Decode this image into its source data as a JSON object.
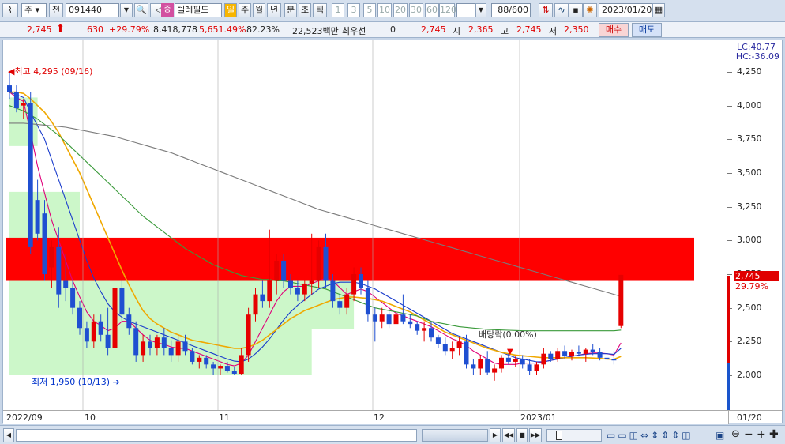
{
  "toolbar": {
    "market_type": "주",
    "prev_label": "전",
    "stock_code": "091440",
    "stock_name": "텔레필드",
    "stock_badge": "증",
    "periods": [
      "일",
      "주",
      "월",
      "년",
      "분",
      "초",
      "틱"
    ],
    "active_period": "일",
    "intervals": [
      "1",
      "3",
      "5",
      "10",
      "20",
      "30",
      "60",
      "120"
    ],
    "count_value": "88",
    "count_total": "/600",
    "date": "2023/01/20"
  },
  "quote": {
    "price": "2,745",
    "change": "630",
    "change_pct": "+29.79%",
    "volume": "8,418,778",
    "volume_ratio": "5,651.49%",
    "turnover": "82.23%",
    "amount": "22,523백만",
    "priority_label": "최우선",
    "priority_value": "0",
    "priority_price": "2,745",
    "open_label": "시",
    "open": "2,365",
    "high_label": "고",
    "high": "2,745",
    "low_label": "저",
    "low": "2,350",
    "buy_label": "매수",
    "sell_label": "매도"
  },
  "chart_labels": {
    "lc": "LC:40.77",
    "hc": "HC:-36.09",
    "high_marker": "최고 4,295 (09/16)",
    "low_marker": "최저 1,950 (10/13)",
    "dividend": "배당락(0.00%)",
    "price_tag": "2,745",
    "pct_tag": "29.79%",
    "x_labels": [
      "2022/09",
      "10",
      "11",
      "12",
      "2023/01"
    ],
    "axis_date": "01/20"
  },
  "chart_data": {
    "type": "candlestick",
    "y_ticks": [
      "4,250",
      "4,000",
      "3,750",
      "3,500",
      "3,250",
      "3,000",
      "2,750",
      "2,500",
      "2,250",
      "2,000"
    ],
    "ylim": [
      1900,
      4350
    ],
    "last_price": 2745,
    "last_change_pct": 29.79,
    "period_high": {
      "value": 4295,
      "date": "09/16"
    },
    "period_low": {
      "value": 1950,
      "date": "10/13"
    },
    "candles": [
      [
        4150,
        4250,
        4050,
        4100
      ],
      [
        4100,
        4150,
        3950,
        3980
      ],
      [
        4000,
        4050,
        3900,
        4020
      ],
      [
        4020,
        4100,
        2900,
        2950
      ],
      [
        3300,
        3450,
        3000,
        3050
      ],
      [
        3200,
        3300,
        2700,
        2750
      ],
      [
        2800,
        3000,
        2650,
        2950
      ],
      [
        2950,
        3100,
        2500,
        2600
      ],
      [
        2700,
        2900,
        2550,
        2650
      ],
      [
        2650,
        2700,
        2450,
        2500
      ],
      [
        2500,
        2550,
        2300,
        2350
      ],
      [
        2350,
        2400,
        2200,
        2250
      ],
      [
        2250,
        2450,
        2200,
        2400
      ],
      [
        2400,
        2450,
        2250,
        2300
      ],
      [
        2300,
        2500,
        2150,
        2200
      ],
      [
        2200,
        2700,
        2150,
        2650
      ],
      [
        2650,
        2700,
        2400,
        2450
      ],
      [
        2450,
        2500,
        2300,
        2350
      ],
      [
        2350,
        2400,
        2100,
        2150
      ],
      [
        2150,
        2300,
        2100,
        2250
      ],
      [
        2250,
        2300,
        2150,
        2200
      ],
      [
        2200,
        2300,
        2150,
        2280
      ],
      [
        2280,
        2350,
        2150,
        2200
      ],
      [
        2200,
        2260,
        2100,
        2150
      ],
      [
        2150,
        2300,
        2100,
        2250
      ],
      [
        2250,
        2300,
        2150,
        2180
      ],
      [
        2180,
        2200,
        2080,
        2100
      ],
      [
        2100,
        2150,
        2050,
        2130
      ],
      [
        2130,
        2150,
        2050,
        2080
      ],
      [
        2080,
        2100,
        2000,
        2050
      ],
      [
        2050,
        2080,
        2000,
        2070
      ],
      [
        2070,
        2100,
        2020,
        2030
      ],
      [
        2030,
        2060,
        2000,
        2010
      ],
      [
        2010,
        2200,
        2000,
        2150
      ],
      [
        2150,
        2500,
        2100,
        2450
      ],
      [
        2450,
        2650,
        2400,
        2600
      ],
      [
        2600,
        2700,
        2500,
        2550
      ],
      [
        2550,
        3080,
        2500,
        2700
      ],
      [
        2700,
        2900,
        2600,
        2850
      ],
      [
        2850,
        2900,
        2650,
        2700
      ],
      [
        2700,
        2750,
        2600,
        2650
      ],
      [
        2650,
        2700,
        2550,
        2600
      ],
      [
        2600,
        2700,
        2550,
        2680
      ],
      [
        2680,
        3050,
        2600,
        2700
      ],
      [
        2700,
        3000,
        2650,
        2950
      ],
      [
        2950,
        3050,
        2650,
        2700
      ],
      [
        2700,
        2750,
        2500,
        2550
      ],
      [
        2550,
        2600,
        2450,
        2500
      ],
      [
        2500,
        2650,
        2450,
        2600
      ],
      [
        2600,
        2800,
        2550,
        2750
      ],
      [
        2750,
        2800,
        2600,
        2650
      ],
      [
        2650,
        2700,
        2400,
        2450
      ],
      [
        2450,
        2500,
        2250,
        2400
      ],
      [
        2400,
        2500,
        2350,
        2450
      ],
      [
        2450,
        2500,
        2350,
        2380
      ],
      [
        2380,
        2500,
        2330,
        2450
      ],
      [
        2450,
        2600,
        2380,
        2400
      ],
      [
        2400,
        2450,
        2350,
        2380
      ],
      [
        2380,
        2400,
        2300,
        2330
      ],
      [
        2330,
        2400,
        2250,
        2350
      ],
      [
        2350,
        2400,
        2250,
        2280
      ],
      [
        2280,
        2300,
        2200,
        2230
      ],
      [
        2230,
        2280,
        2150,
        2180
      ],
      [
        2180,
        2250,
        2120,
        2200
      ],
      [
        2200,
        2280,
        2150,
        2250
      ],
      [
        2250,
        2300,
        2050,
        2080
      ],
      [
        2080,
        2120,
        2000,
        2050
      ],
      [
        2050,
        2150,
        2000,
        2120
      ],
      [
        2120,
        2180,
        2000,
        2020
      ],
      [
        2020,
        2080,
        1960,
        2050
      ],
      [
        2050,
        2150,
        2020,
        2130
      ],
      [
        2130,
        2160,
        2080,
        2100
      ],
      [
        2100,
        2140,
        2060,
        2120
      ],
      [
        2120,
        2150,
        2050,
        2080
      ],
      [
        2080,
        2120,
        2000,
        2030
      ],
      [
        2030,
        2100,
        2000,
        2080
      ],
      [
        2080,
        2200,
        2050,
        2160
      ],
      [
        2160,
        2180,
        2100,
        2120
      ],
      [
        2120,
        2200,
        2100,
        2180
      ],
      [
        2180,
        2220,
        2120,
        2140
      ],
      [
        2140,
        2190,
        2110,
        2170
      ],
      [
        2170,
        2220,
        2140,
        2160
      ],
      [
        2160,
        2200,
        2100,
        2190
      ],
      [
        2190,
        2230,
        2150,
        2170
      ],
      [
        2170,
        2200,
        2110,
        2130
      ],
      [
        2130,
        2180,
        2100,
        2120
      ],
      [
        2120,
        2180,
        2080,
        2110
      ],
      [
        2365,
        2745,
        2350,
        2745
      ]
    ],
    "series": [
      {
        "type": "ma",
        "color": "#e0007a",
        "values": [
          4100,
          4060,
          4030,
          3800,
          3550,
          3350,
          3150,
          3000,
          2850,
          2700,
          2580,
          2470,
          2400,
          2370,
          2330,
          2350,
          2400,
          2400,
          2350,
          2300,
          2260,
          2240,
          2230,
          2210,
          2200,
          2200,
          2180,
          2160,
          2140,
          2120,
          2100,
          2080,
          2070,
          2090,
          2150,
          2250,
          2350,
          2450,
          2550,
          2620,
          2660,
          2660,
          2660,
          2680,
          2700,
          2720,
          2700,
          2650,
          2600,
          2620,
          2640,
          2620,
          2580,
          2540,
          2500,
          2460,
          2440,
          2420,
          2400,
          2380,
          2360,
          2330,
          2300,
          2270,
          2250,
          2220,
          2180,
          2150,
          2120,
          2090,
          2080,
          2080,
          2080,
          2090,
          2090,
          2090,
          2100,
          2110,
          2120,
          2130,
          2140,
          2150,
          2160,
          2165,
          2165,
          2160,
          2150,
          2240
        ]
      },
      {
        "type": "ma",
        "color": "#1a3ccc",
        "values": [
          4100,
          4080,
          4060,
          3950,
          3850,
          3750,
          3600,
          3450,
          3300,
          3150,
          3000,
          2850,
          2720,
          2620,
          2530,
          2470,
          2430,
          2400,
          2380,
          2360,
          2340,
          2320,
          2300,
          2280,
          2260,
          2240,
          2220,
          2200,
          2180,
          2160,
          2140,
          2120,
          2105,
          2100,
          2120,
          2160,
          2210,
          2270,
          2340,
          2410,
          2470,
          2520,
          2560,
          2600,
          2640,
          2660,
          2680,
          2690,
          2690,
          2690,
          2680,
          2660,
          2640,
          2610,
          2580,
          2550,
          2520,
          2490,
          2460,
          2430,
          2400,
          2370,
          2340,
          2310,
          2290,
          2270,
          2250,
          2230,
          2210,
          2190,
          2170,
          2150,
          2130,
          2120,
          2110,
          2100,
          2100,
          2110,
          2120,
          2130,
          2140,
          2150,
          2155,
          2160,
          2160,
          2160,
          2155,
          2200
        ]
      },
      {
        "type": "ma",
        "color": "#f0a800",
        "values": [
          4100,
          4100,
          4090,
          4050,
          4000,
          3950,
          3880,
          3800,
          3700,
          3600,
          3500,
          3380,
          3260,
          3140,
          3020,
          2900,
          2780,
          2670,
          2570,
          2480,
          2420,
          2380,
          2350,
          2320,
          2300,
          2280,
          2260,
          2250,
          2240,
          2230,
          2220,
          2210,
          2200,
          2200,
          2210,
          2230,
          2260,
          2300,
          2340,
          2380,
          2420,
          2450,
          2480,
          2500,
          2520,
          2540,
          2560,
          2570,
          2580,
          2580,
          2575,
          2570,
          2560,
          2550,
          2530,
          2510,
          2490,
          2470,
          2440,
          2410,
          2380,
          2350,
          2320,
          2300,
          2280,
          2260,
          2240,
          2220,
          2200,
          2185,
          2170,
          2160,
          2150,
          2145,
          2140,
          2135,
          2130,
          2130,
          2130,
          2130,
          2130,
          2130,
          2130,
          2128,
          2125,
          2120,
          2118,
          2140
        ]
      },
      {
        "type": "ma",
        "color": "#3a9a3a",
        "values": [
          4000,
          3980,
          3960,
          3930,
          3900,
          3860,
          3820,
          3780,
          3730,
          3680,
          3630,
          3580,
          3530,
          3480,
          3430,
          3380,
          3330,
          3280,
          3230,
          3180,
          3140,
          3100,
          3060,
          3020,
          2980,
          2940,
          2910,
          2880,
          2850,
          2820,
          2800,
          2780,
          2760,
          2740,
          2730,
          2720,
          2710,
          2710,
          2700,
          2700,
          2690,
          2680,
          2670,
          2660,
          2650,
          2640,
          2620,
          2600,
          2580,
          2560,
          2540,
          2520,
          2500,
          2490,
          2480,
          2470,
          2460,
          2450,
          2440,
          2420,
          2400,
          2390,
          2380,
          2370,
          2360,
          2355,
          2350,
          2345,
          2340,
          2338,
          2336,
          2334,
          2332,
          2330,
          2330,
          2330,
          2330,
          2330,
          2330,
          2330,
          2330,
          2330,
          2330,
          2330,
          2330,
          2330,
          2330,
          2335
        ]
      },
      {
        "type": "ma",
        "color": "#7a7a7a",
        "values": [
          3870,
          3870,
          3870,
          3865,
          3860,
          3855,
          3850,
          3845,
          3840,
          3830,
          3820,
          3810,
          3800,
          3790,
          3780,
          3770,
          3755,
          3740,
          3725,
          3710,
          3695,
          3680,
          3665,
          3650,
          3630,
          3610,
          3590,
          3570,
          3550,
          3530,
          3510,
          3490,
          3470,
          3450,
          3430,
          3410,
          3390,
          3370,
          3350,
          3330,
          3310,
          3290,
          3270,
          3250,
          3230,
          3215,
          3200,
          3185,
          3170,
          3155,
          3140,
          3125,
          3110,
          3095,
          3080,
          3065,
          3050,
          3035,
          3020,
          3005,
          2990,
          2975,
          2960,
          2945,
          2930,
          2915,
          2900,
          2885,
          2870,
          2855,
          2840,
          2825,
          2810,
          2795,
          2780,
          2765,
          2750,
          2735,
          2720,
          2705,
          2690,
          2675,
          2660,
          2645,
          2630,
          2615,
          2600,
          2585
        ]
      }
    ],
    "zones": [
      {
        "color": "#ff0000",
        "from_value": 2700,
        "to_value": 3020
      }
    ]
  }
}
